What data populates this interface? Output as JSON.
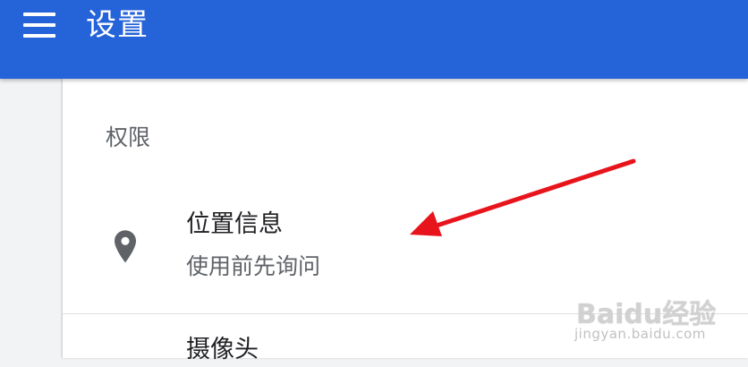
{
  "header": {
    "title": "设置",
    "background": "#2563d9"
  },
  "section": {
    "heading": "权限"
  },
  "rows": [
    {
      "title": "位置信息",
      "subtitle": "使用前先询问",
      "icon": "location-pin-icon"
    },
    {
      "title": "摄像头"
    }
  ],
  "annotation": {
    "arrow_color": "#e8141c"
  },
  "watermark": {
    "logo": "Baidu经验",
    "url": "jingyan.baidu.com"
  }
}
